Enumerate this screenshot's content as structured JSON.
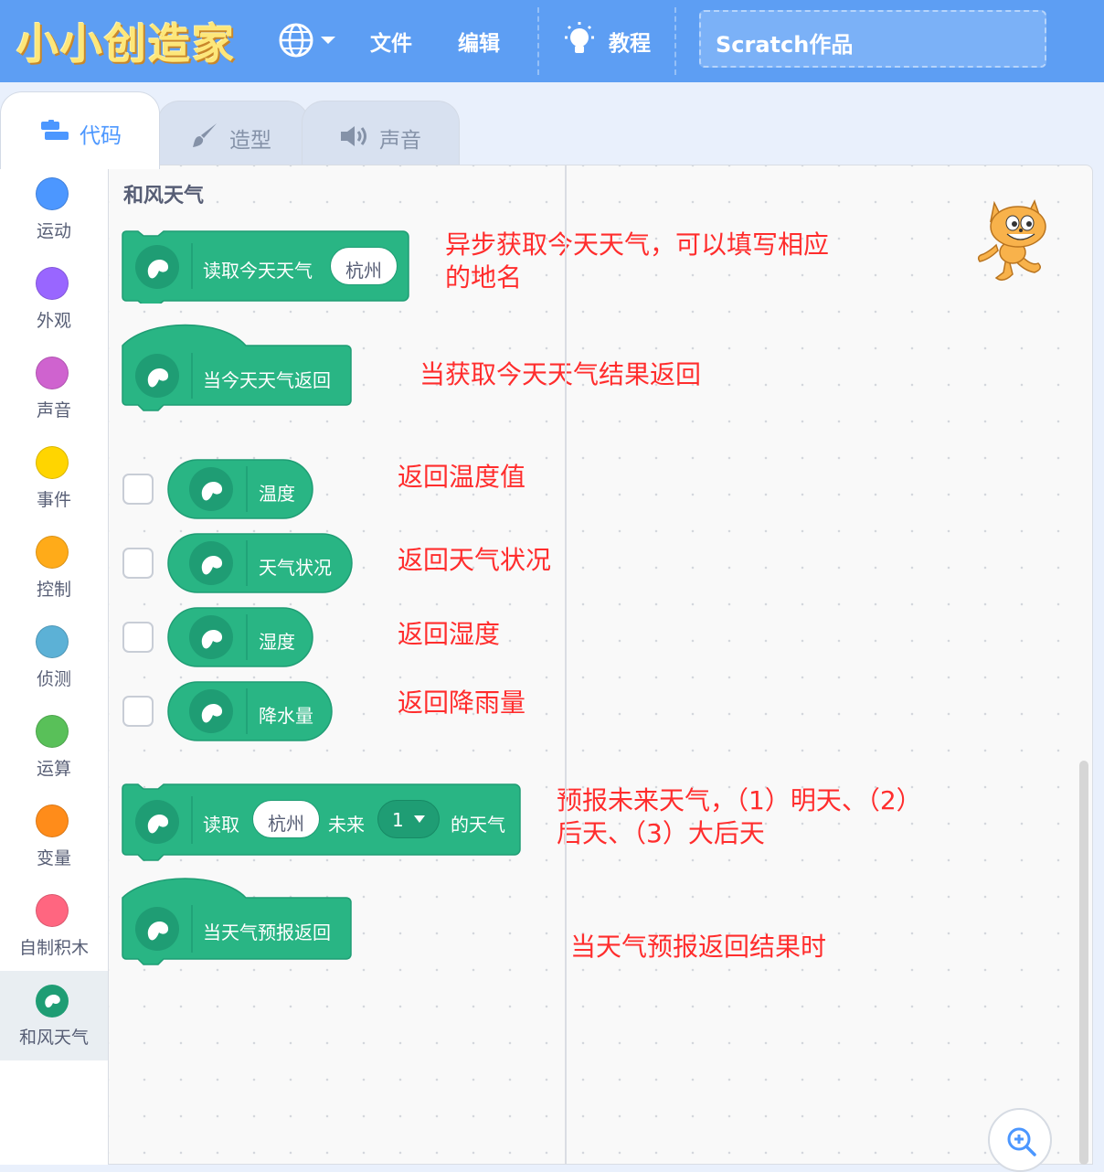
{
  "menubar": {
    "logo": "小小创造家",
    "file": "文件",
    "edit": "编辑",
    "tutorials": "教程",
    "project_title": "Scratch作品"
  },
  "tabs": [
    {
      "label": "代码",
      "icon": "code-icon",
      "active": true
    },
    {
      "label": "造型",
      "icon": "brush-icon",
      "active": false
    },
    {
      "label": "声音",
      "icon": "speaker-icon",
      "active": false
    }
  ],
  "categories": [
    {
      "label": "运动",
      "color": "#4c97ff"
    },
    {
      "label": "外观",
      "color": "#9966ff"
    },
    {
      "label": "声音",
      "color": "#cf63cf"
    },
    {
      "label": "事件",
      "color": "#ffd500"
    },
    {
      "label": "控制",
      "color": "#ffab19"
    },
    {
      "label": "侦测",
      "color": "#5cb1d6"
    },
    {
      "label": "运算",
      "color": "#59c059"
    },
    {
      "label": "变量",
      "color": "#ff8c1a"
    },
    {
      "label": "自制积木",
      "color": "#ff6680"
    },
    {
      "label": "和风天气",
      "color": "#1f9d74",
      "selected": true
    }
  ],
  "flyout": {
    "section_title": "和风天气",
    "blocks": {
      "read_today": {
        "text": "读取今天天气",
        "city": "杭州"
      },
      "when_today_returned": {
        "text": "当今天天气返回"
      },
      "temperature": {
        "text": "温度"
      },
      "weather_status": {
        "text": "天气状况"
      },
      "humidity": {
        "text": "湿度"
      },
      "precipitation": {
        "text": "降水量"
      },
      "read_forecast": {
        "prefix": "读取",
        "city": "杭州",
        "middle": "未来",
        "days": "1",
        "suffix": "的天气"
      },
      "when_forecast_returned": {
        "text": "当天气预报返回"
      }
    }
  },
  "annotations": {
    "read_today": [
      "异步获取今天天气，可以填写相应",
      "的地名"
    ],
    "when_today_returned": "当获取今天天气结果返回",
    "temperature": "返回温度值",
    "weather_status": "返回天气状况",
    "humidity": "返回湿度",
    "precipitation": "返回降雨量",
    "read_forecast": [
      "预报未来天气，（1）明天、（2）",
      "后天、（3）大后天"
    ],
    "when_forecast_returned": "当天气预报返回结果时"
  },
  "colors": {
    "menubar": "#5d9ef3",
    "block": "#29b584",
    "block_dark": "#1f9d74",
    "annotation": "#ff2d2d",
    "accent": "#4c97ff"
  }
}
